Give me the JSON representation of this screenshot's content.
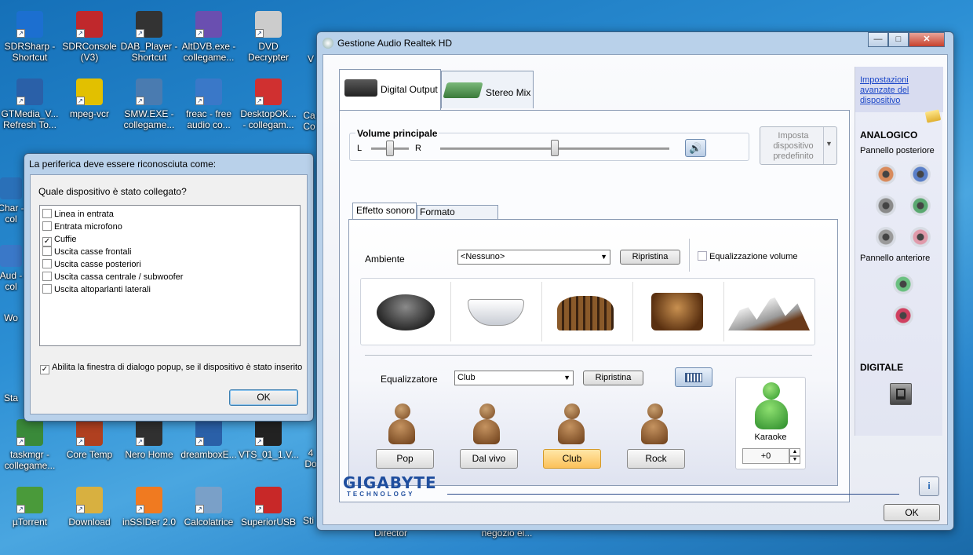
{
  "desktop": {
    "icons": [
      {
        "label": "SDRSharp - Shortcut",
        "color": "#1c6fd0"
      },
      {
        "label": "SDRConsole (V3)",
        "color": "#c0282c"
      },
      {
        "label": "DAB_Player - Shortcut",
        "color": "#333"
      },
      {
        "label": "AltDVB.exe - collegame...",
        "color": "#6a4fb0"
      },
      {
        "label": "DVD Decrypter",
        "color": "#ccc"
      },
      {
        "label": "GTMedia_V... Refresh To...",
        "color": "#2a60a8"
      },
      {
        "label": "mpeg-vcr",
        "color": "#e2c000"
      },
      {
        "label": "SMW.EXE - collegame...",
        "color": "#4a7bb0"
      },
      {
        "label": "freac - free audio co...",
        "color": "#3a78c8"
      },
      {
        "label": "DesktopOK... - collegam...",
        "color": "#d03030"
      },
      {
        "label": "taskmgr - collegame...",
        "color": "#3a8a3a"
      },
      {
        "label": "Core Temp",
        "color": "#b04020"
      },
      {
        "label": "Nero Home",
        "color": "#303030"
      },
      {
        "label": "dreamboxE...",
        "color": "#2a60a8"
      },
      {
        "label": "VTS_01_1.V...",
        "color": "#222"
      },
      {
        "label": "µTorrent",
        "color": "#4a9a3a"
      },
      {
        "label": "Download",
        "color": "#d8b040"
      },
      {
        "label": "inSSIDer 2.0",
        "color": "#f07a20"
      },
      {
        "label": "Calcolatrice",
        "color": "#7aa0c8"
      },
      {
        "label": "SuperiorUSB",
        "color": "#c82828"
      }
    ],
    "partial_labels": [
      "Char - col",
      "Aud - col",
      "Wo",
      "Sta",
      "Ca Co",
      "V",
      "4 Do",
      "Sti",
      "Director",
      "negozio el..."
    ]
  },
  "dialog": {
    "title": "La periferica deve essere riconosciuta come:",
    "question": "Quale dispositivo è stato collegato?",
    "options": [
      {
        "label": "Linea in entrata",
        "checked": false
      },
      {
        "label": "Entrata microfono",
        "checked": false
      },
      {
        "label": "Cuffie",
        "checked": true
      },
      {
        "label": "Uscita casse frontali",
        "checked": false
      },
      {
        "label": "Uscita casse posteriori",
        "checked": false
      },
      {
        "label": "Uscita cassa centrale / subwoofer",
        "checked": false
      },
      {
        "label": "Uscita altoparlanti laterali",
        "checked": false
      }
    ],
    "popup_label": "Abilita la finestra di dialogo popup, se il dispositivo è stato inserito",
    "popup_checked": true,
    "ok": "OK"
  },
  "realtek": {
    "title": "Gestione Audio Realtek HD",
    "controls": {
      "min": "—",
      "max": "□",
      "close": "✕"
    },
    "tabs": [
      "Digital Output",
      "Stereo Mix"
    ],
    "volume": {
      "label": "Volume principale",
      "l": "L",
      "r": "R",
      "balance": 0.5,
      "level": 0.5,
      "default_device": "Imposta dispositivo predefinito"
    },
    "subtabs": [
      "Effetto sonoro",
      "Formato predefinito"
    ],
    "ambiente": {
      "label": "Ambiente",
      "value": "<Nessuno>",
      "reset": "Ripristina",
      "eq_volume": "Equalizzazione volume",
      "eq_volume_checked": false
    },
    "environments": [
      "stone",
      "bathroom",
      "colosseum",
      "sewer",
      "opera"
    ],
    "equalizer": {
      "label": "Equalizzatore",
      "value": "Club",
      "reset": "Ripristina",
      "presets": [
        {
          "label": "Pop",
          "active": false
        },
        {
          "label": "Dal vivo",
          "active": false
        },
        {
          "label": "Club",
          "active": true
        },
        {
          "label": "Rock",
          "active": false
        }
      ]
    },
    "karaoke": {
      "label": "Karaoke",
      "value": "+0"
    },
    "side": {
      "link": "Impostazioni avanzate del dispositivo",
      "analog": "ANALOGICO",
      "rear": "Pannello posteriore",
      "front": "Pannello anteriore",
      "digital": "DIGITALE"
    },
    "jacks_rear": [
      "#d88a5c",
      "#5a7fc8",
      "#8a8a8a",
      "#5aa870",
      "#9a9a9a",
      "#e09aaa"
    ],
    "jacks_front": [
      "#6ac080",
      "#d04060"
    ],
    "brand": "GIGABYTE",
    "brand_sub": "TECHNOLOGY",
    "ok": "OK",
    "info": "i"
  }
}
